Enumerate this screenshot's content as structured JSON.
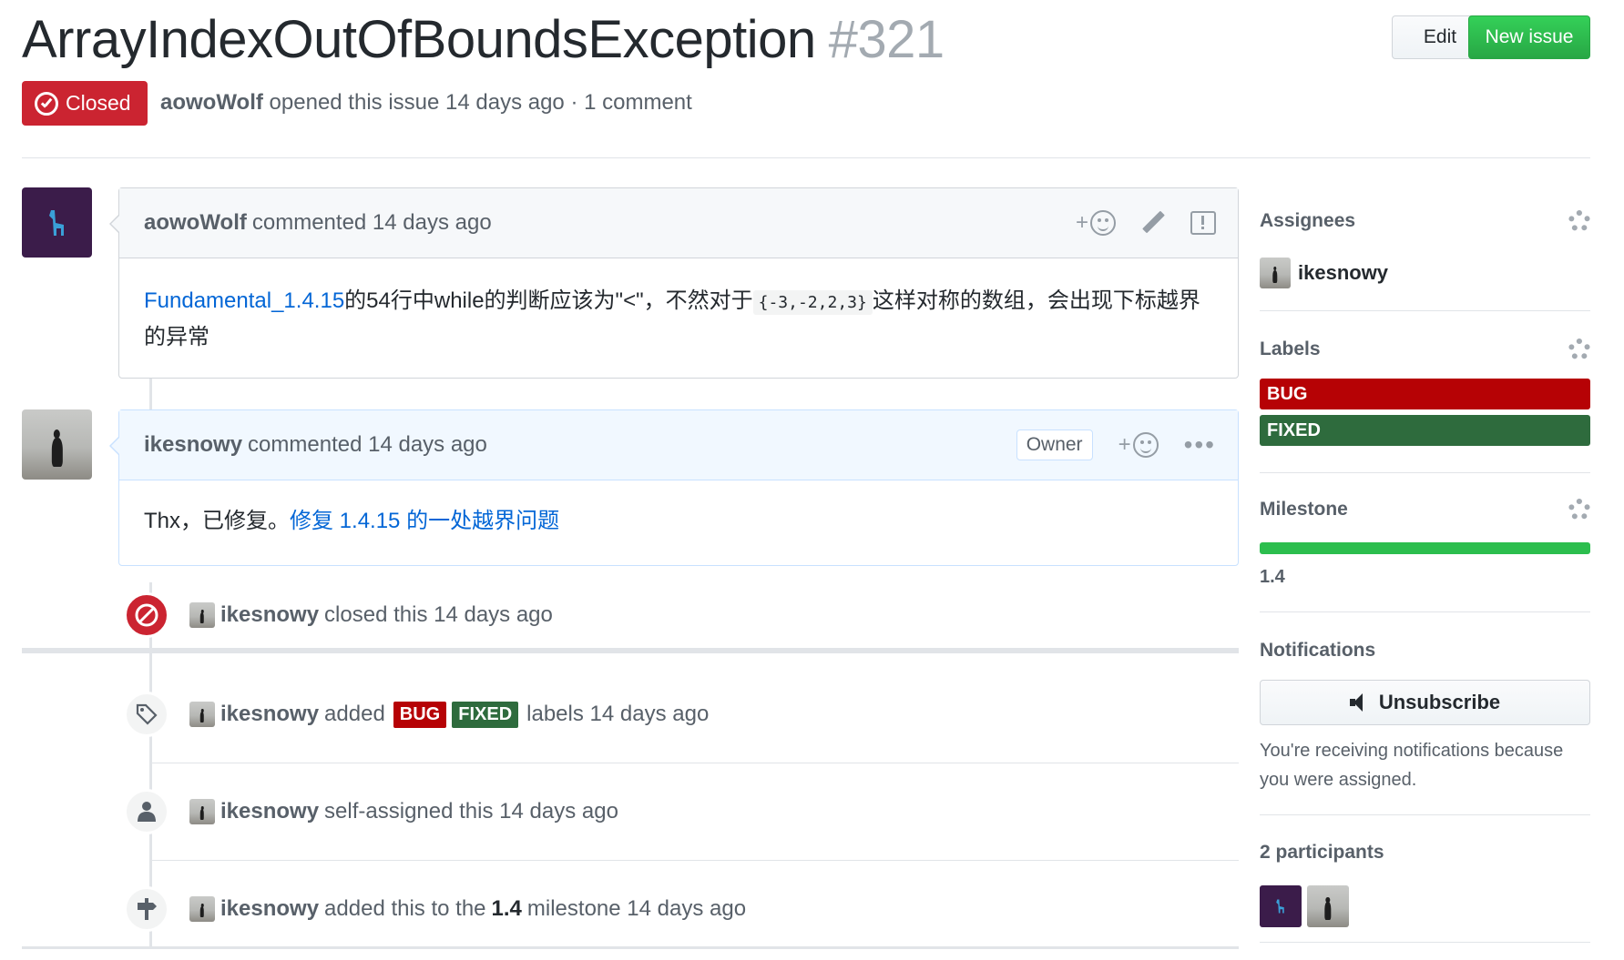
{
  "issue": {
    "title": "ArrayIndexOutOfBoundsException",
    "number": "#321",
    "state": "Closed",
    "author": "aowoWolf",
    "meta_suffix": "opened this issue 14 days ago · 1 comment"
  },
  "header_buttons": {
    "edit": "Edit",
    "new_issue": "New issue"
  },
  "comments": [
    {
      "author": "aowoWolf",
      "action": "commented 14 days ago",
      "link_text": "Fundamental_1.4.15",
      "text_1": "的54行中while的判断应该为\"<\"，不然对于",
      "code": "{-3,-2,2,3}",
      "text_2": "这样对称的数组，会出现下标越界的异常"
    },
    {
      "author": "ikesnowy",
      "action": "commented 14 days ago",
      "badge": "Owner",
      "text_1": "Thx，已修复。",
      "link_text": "修复 1.4.15 的一处越界问题"
    }
  ],
  "reaction_plus": "+",
  "events": {
    "closed": {
      "user": "ikesnowy",
      "text": "closed this 14 days ago"
    },
    "labeled": {
      "user": "ikesnowy",
      "prefix": "added",
      "label_1": "BUG",
      "label_2": "FIXED",
      "suffix": "labels 14 days ago"
    },
    "assigned": {
      "user": "ikesnowy",
      "text": "self-assigned this 14 days ago"
    },
    "milestone": {
      "user": "ikesnowy",
      "prefix": "added this to the",
      "milestone": "1.4",
      "suffix": "milestone 14 days ago"
    }
  },
  "sidebar": {
    "assignees": {
      "title": "Assignees",
      "user": "ikesnowy"
    },
    "labels": {
      "title": "Labels",
      "items": [
        {
          "name": "BUG",
          "color": "#b60205"
        },
        {
          "name": "FIXED",
          "color": "#2e6b3d"
        }
      ]
    },
    "milestone": {
      "title": "Milestone",
      "name": "1.4",
      "progress": 1.0
    },
    "notifications": {
      "title": "Notifications",
      "button": "Unsubscribe",
      "reason": "You're receiving notifications because you were assigned."
    },
    "participants": {
      "title": "2 participants"
    }
  },
  "colors": {
    "closed": "#cb2431",
    "primary_button": "#28a745",
    "link": "#0366d6",
    "bug": "#b60205",
    "fixed": "#2e6b3d",
    "milestone_progress": "#2cbe4e"
  }
}
